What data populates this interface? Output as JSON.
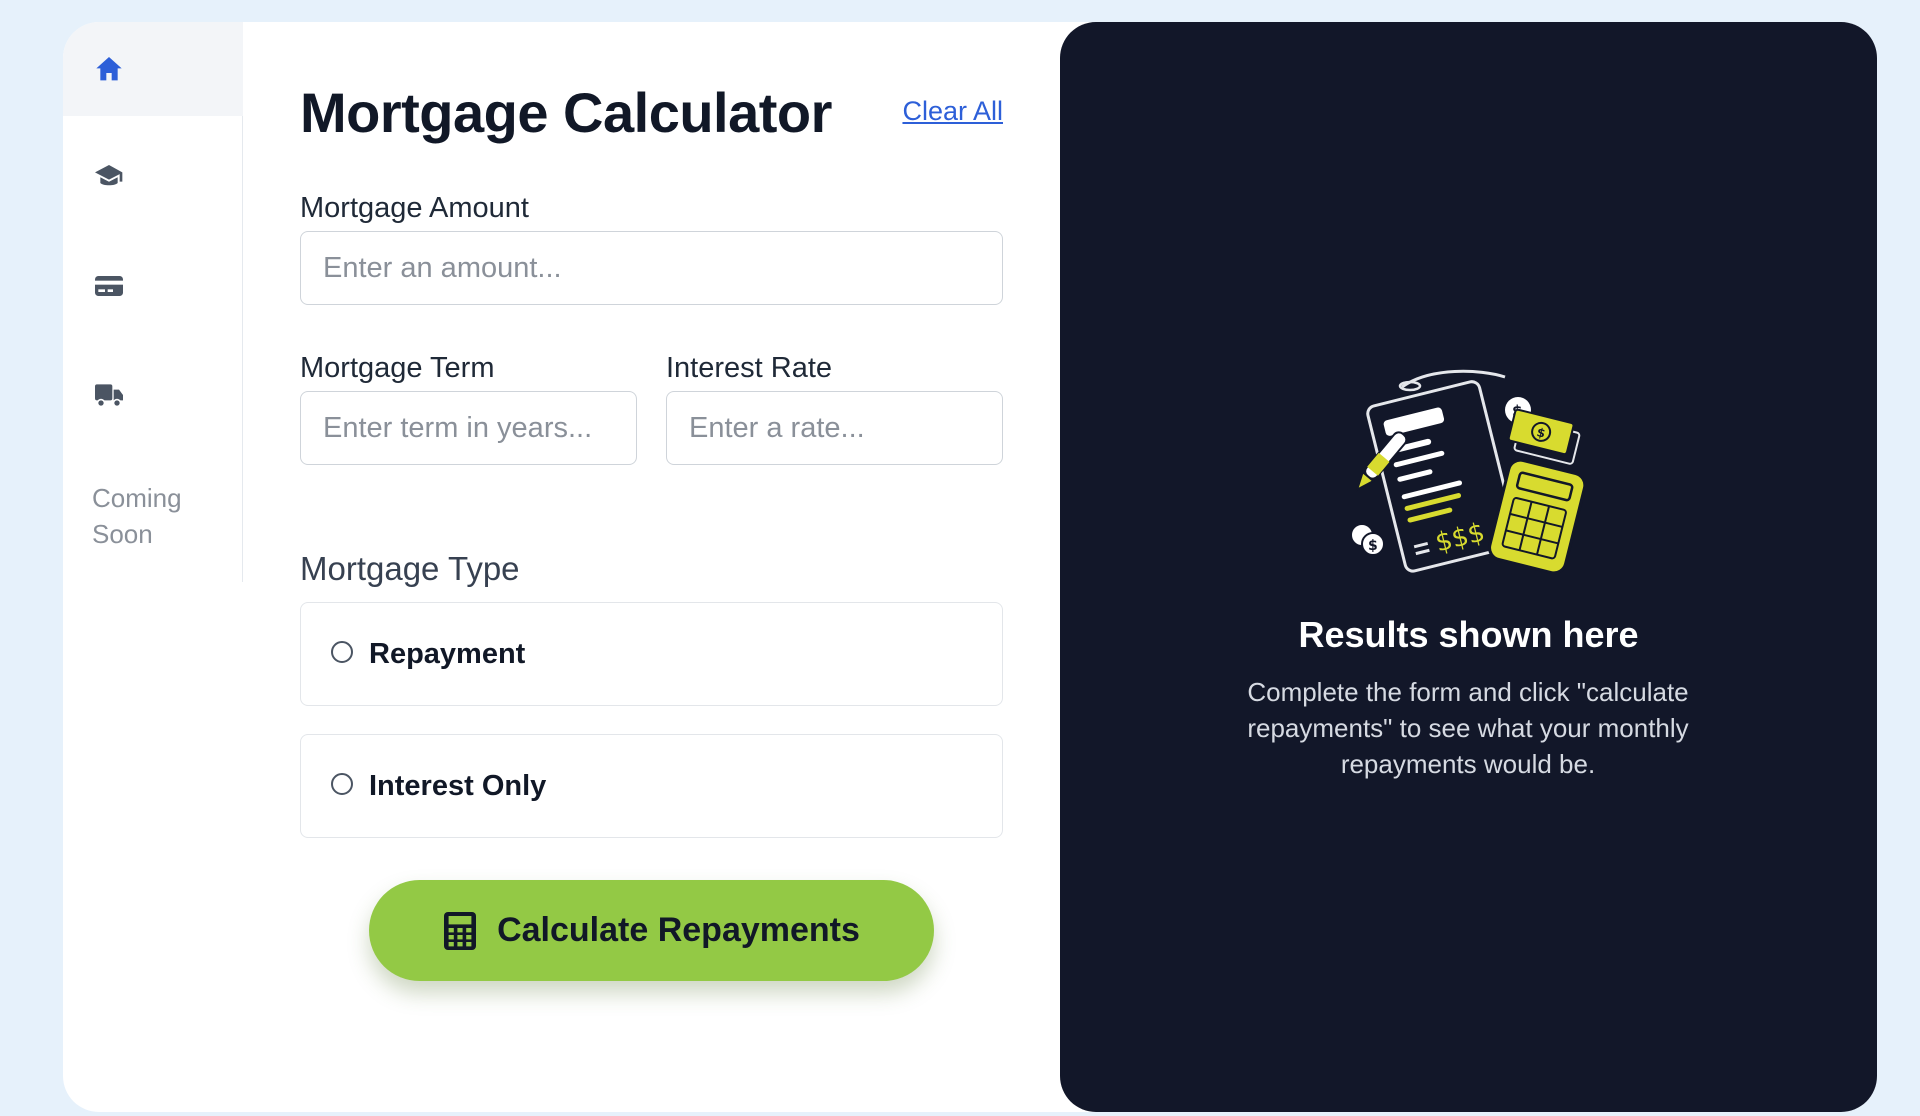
{
  "sidebar": {
    "items": [
      {
        "icon": "home-icon",
        "active": true
      },
      {
        "icon": "graduation-cap-icon",
        "active": false
      },
      {
        "icon": "credit-card-icon",
        "active": false
      },
      {
        "icon": "truck-icon",
        "active": false
      }
    ],
    "coming_soon": "Coming Soon"
  },
  "form": {
    "title": "Mortgage Calculator",
    "clear_all": "Clear All",
    "amount": {
      "label": "Mortgage Amount",
      "placeholder": "Enter an amount...",
      "value": ""
    },
    "term": {
      "label": "Mortgage Term",
      "placeholder": "Enter term in years...",
      "value": ""
    },
    "rate": {
      "label": "Interest Rate",
      "placeholder": "Enter a rate...",
      "value": ""
    },
    "type": {
      "label": "Mortgage Type",
      "options": [
        {
          "label": "Repayment",
          "selected": false
        },
        {
          "label": "Interest Only",
          "selected": false
        }
      ]
    },
    "submit": {
      "label": "Calculate Repayments",
      "icon": "calculator-icon"
    }
  },
  "results": {
    "title": "Results shown here",
    "text": "Complete the form and click \"calculate repayments\" to see what your monthly repayments would be."
  },
  "colors": {
    "accent": "#93c945",
    "panel": "#121729",
    "link": "#2d5fd8",
    "background": "#e6f1fb"
  }
}
